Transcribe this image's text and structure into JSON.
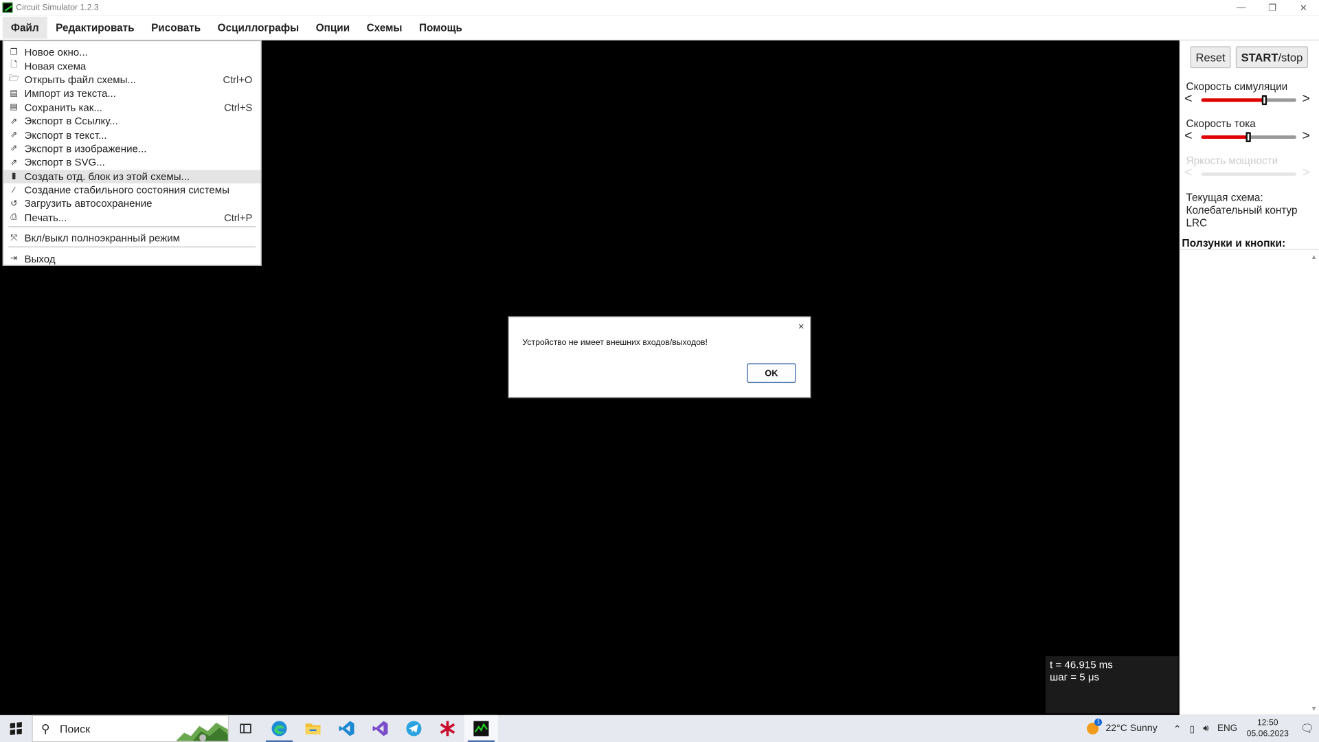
{
  "window": {
    "title": "Circuit Simulator 1.2.3",
    "controls": [
      "—",
      "❐",
      "✕"
    ]
  },
  "menubar": {
    "items": [
      "Файл",
      "Редактировать",
      "Рисовать",
      "Осциллографы",
      "Опции",
      "Схемы",
      "Помощь"
    ]
  },
  "file_menu": {
    "items": [
      {
        "icon": "new-window-icon",
        "label": "Новое окно...",
        "shortcut": ""
      },
      {
        "icon": "new-document-icon",
        "label": "Новая схема",
        "shortcut": ""
      },
      {
        "icon": "folder-open-icon",
        "label": "Открыть файл схемы...",
        "shortcut": "Ctrl+O"
      },
      {
        "icon": "import-text-icon",
        "label": "Импорт из текста...",
        "shortcut": ""
      },
      {
        "icon": "save-icon",
        "label": "Сохранить как...",
        "shortcut": "Ctrl+S"
      },
      {
        "icon": "export-icon",
        "label": "Экспорт в Ссылку...",
        "shortcut": ""
      },
      {
        "icon": "export-icon",
        "label": "Экспорт в текст...",
        "shortcut": ""
      },
      {
        "icon": "export-icon",
        "label": "Экспорт в изображение...",
        "shortcut": ""
      },
      {
        "icon": "export-icon",
        "label": "Экспорт в SVG...",
        "shortcut": ""
      },
      {
        "icon": "chip-icon",
        "label": "Создать отд. блок из этой схемы...",
        "shortcut": ""
      },
      {
        "icon": "magic-wand-icon",
        "label": "Создание стабильного состояния системы",
        "shortcut": ""
      },
      {
        "icon": "history-icon",
        "label": "Загрузить автосохранение",
        "shortcut": ""
      },
      {
        "icon": "print-icon",
        "label": "Печать...",
        "shortcut": "Ctrl+P"
      }
    ],
    "fullscreen": {
      "icon": "fullscreen-icon",
      "label": "Вкл/выкл полноэкранный режим"
    },
    "exit": {
      "icon": "exit-icon",
      "label": "Выход"
    }
  },
  "panel": {
    "reset_label": "Reset",
    "start_label": "START",
    "stop_label": "/stop",
    "sim_speed_label": "Скорость симуляции",
    "sim_speed_value": 0.67,
    "current_speed_label": "Скорость тока",
    "current_speed_value": 0.5,
    "power_brightness_label": "Яркость мощности",
    "current_circuit_label": "Текущая схема:",
    "current_circuit_name": "Колебательный контур LRC",
    "sliders_buttons_label": "Ползунки и кнопки:"
  },
  "status": {
    "time": "t = 46.915 ms",
    "step": "шаг = 5 μs"
  },
  "dialog": {
    "message": "Устройство не имеет внешних входов/выходов!",
    "ok_label": "OK",
    "close": "×"
  },
  "taskbar": {
    "search_placeholder": "Поиск",
    "weather": "22°C  Sunny",
    "language": "ENG",
    "time": "12:50",
    "date": "05.06.2023"
  },
  "colors": {
    "slider_fill": "#e00000",
    "canvas_bg": "#000000",
    "ok_border": "#2b5ea8"
  }
}
